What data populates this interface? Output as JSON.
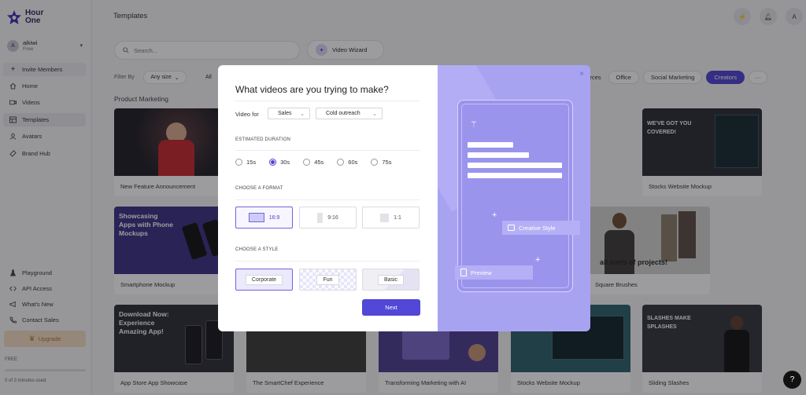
{
  "app": {
    "logo_line1": "Hour",
    "logo_line2": "One",
    "page_title": "Templates"
  },
  "account": {
    "initial": "A",
    "name": "aikiwi",
    "plan": "Free"
  },
  "sidebar": {
    "invite": "Invite Members",
    "items": [
      {
        "label": "Home",
        "icon": "home-icon"
      },
      {
        "label": "Videos",
        "icon": "video-icon"
      },
      {
        "label": "Templates",
        "icon": "templates-icon"
      },
      {
        "label": "Avatars",
        "icon": "avatar-icon"
      },
      {
        "label": "Brand Hub",
        "icon": "brand-icon"
      }
    ],
    "bottom_items": [
      {
        "label": "Playground",
        "icon": "flask-icon"
      },
      {
        "label": "API Access",
        "icon": "code-icon"
      },
      {
        "label": "What's New",
        "icon": "megaphone-icon"
      },
      {
        "label": "Contact Sales",
        "icon": "phone-icon"
      }
    ],
    "upgrade": "Upgrade",
    "free_label": "FREE",
    "usage_text": "0 of 3 minutes used",
    "usage_fraction": 0
  },
  "toolbar": {
    "search_placeholder": "Search...",
    "wizard_label": "Video Wizard",
    "filter_label": "Filter By",
    "size_select": "Any size",
    "chip_all": "All",
    "chips": [
      "ources",
      "Office",
      "Social Marketing",
      "Creators"
    ],
    "more": "···"
  },
  "section_title": "Product Marketing",
  "cards": [
    {
      "caption": "New Feature Announcement",
      "thumb_text": ""
    },
    {
      "caption": "Stocks Website Mockup",
      "thumb_text": "WE'VE GOT YOU COVERED!"
    },
    {
      "caption": "Smartphone Mockup",
      "thumb_text": "Showcasing Apps with Phone Mockups"
    },
    {
      "caption": "Square Brushes",
      "thumb_text": "all sorts of projects!"
    },
    {
      "caption": "App Store App Showcase",
      "thumb_text": "Download Now: Experience Amazing App!"
    },
    {
      "caption": "The SmartChef Experience",
      "thumb_text": ""
    },
    {
      "caption": "Transforming Marketing with AI",
      "thumb_text": ""
    },
    {
      "caption": "Stocks Website Mockup",
      "thumb_text": ""
    },
    {
      "caption": "Sliding Slashes",
      "thumb_text": "SLASHES MAKE SPLASHES"
    }
  ],
  "modal": {
    "title": "What videos are you trying to make?",
    "video_for_label": "Video for",
    "video_for_value": "Sales",
    "video_type_value": "Cold outreach",
    "duration_heading": "ESTIMATED DURATION",
    "durations": [
      "15s",
      "30s",
      "45s",
      "60s",
      "75s"
    ],
    "selected_duration": "30s",
    "format_heading": "CHOOSE A FORMAT",
    "formats": [
      "16:9",
      "9:16",
      "1:1"
    ],
    "selected_format": "16:9",
    "style_heading": "CHOOSE A STYLE",
    "styles": [
      "Corporate",
      "Fun",
      "Basic"
    ],
    "selected_style": "Corporate",
    "next_label": "Next",
    "close": "×",
    "preview_creative": "Creative Style",
    "preview_label": "Preview"
  },
  "help": "?",
  "colors": {
    "accent": "#5247d6",
    "panel": "#a8a3f1",
    "upgrade_bg": "#f3dcc1"
  }
}
